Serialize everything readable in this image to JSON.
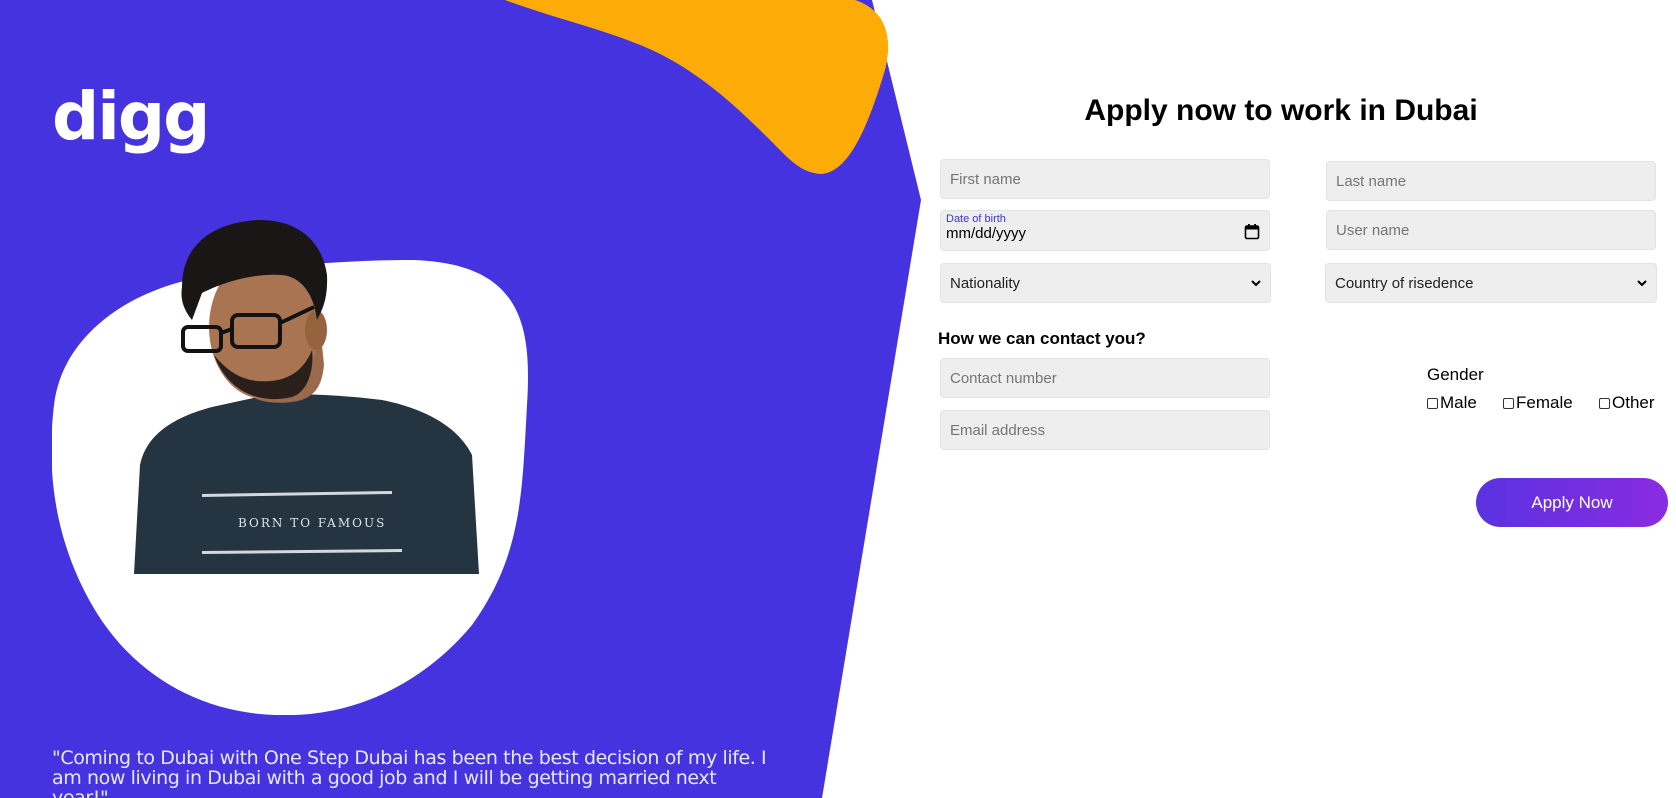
{
  "colors": {
    "panel": "#4633e0",
    "blob": "#fdab07",
    "button_start": "#5a32df",
    "button_end": "#8a2be2",
    "field_bg": "#eeeeee"
  },
  "brand": {
    "logo_text": "digg"
  },
  "testimonial": {
    "image_alt": "Young man with glasses wearing a dark t-shirt",
    "quote": "\"Coming to Dubai with One Step Dubai has been the best decision of my life. I am now living in Dubai with a good job and I will be getting married next year!\""
  },
  "form": {
    "title": "Apply now to work in Dubai",
    "first_name_placeholder": "First name",
    "last_name_placeholder": "Last name",
    "dob_label": "Date of birth",
    "dob_value": "mm/dd/yyyy",
    "username_placeholder": "User name",
    "nationality_selected": "Nationality",
    "country_selected": "Country of risedence",
    "contact_heading": "How we can contact you?",
    "contact_number_placeholder": "Contact number",
    "email_placeholder": "Email address",
    "gender_label": "Gender",
    "gender_options": [
      "Male",
      "Female",
      "Other"
    ],
    "submit_label": "Apply Now"
  }
}
